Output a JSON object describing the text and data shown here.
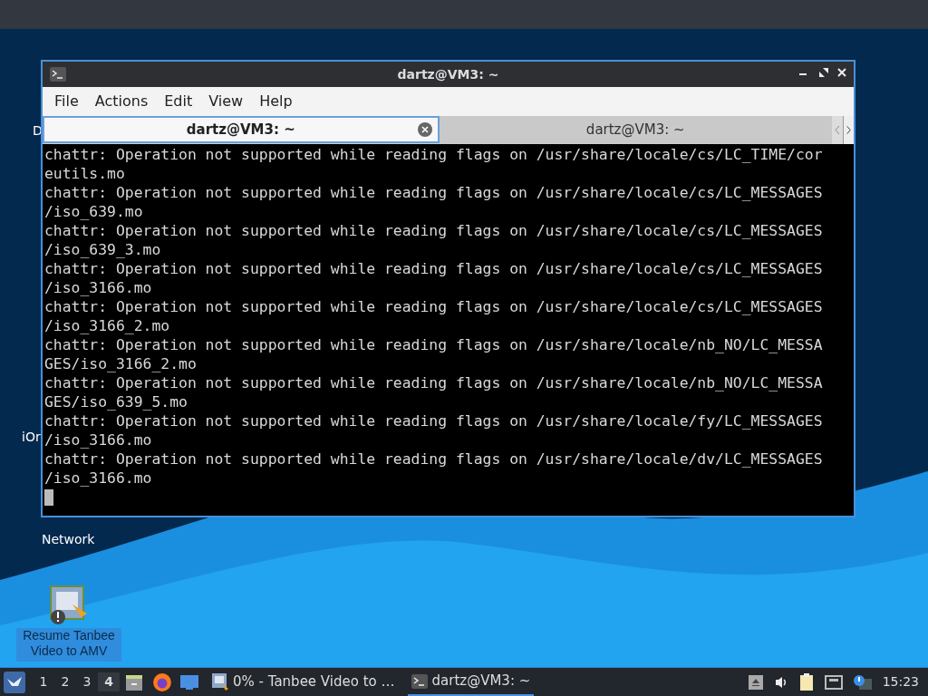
{
  "desktop_icons": [
    {
      "label": "D",
      "kind": "cut"
    },
    {
      "label": "iOr",
      "kind": "cut"
    },
    {
      "label": "Network",
      "kind": "network"
    },
    {
      "label": "Resume Tanbee Video to AMV",
      "kind": "app"
    }
  ],
  "window": {
    "title": "dartz@VM3: ~"
  },
  "menu": [
    "File",
    "Actions",
    "Edit",
    "View",
    "Help"
  ],
  "tabs": [
    {
      "label": "dartz@VM3: ~",
      "selected": true
    },
    {
      "label": "dartz@VM3: ~",
      "selected": false
    }
  ],
  "terminal_lines": [
    "chattr: Operation not supported while reading flags on /usr/share/locale/cs/LC_TIME/cor",
    "eutils.mo",
    "chattr: Operation not supported while reading flags on /usr/share/locale/cs/LC_MESSAGES",
    "/iso_639.mo",
    "chattr: Operation not supported while reading flags on /usr/share/locale/cs/LC_MESSAGES",
    "/iso_639_3.mo",
    "chattr: Operation not supported while reading flags on /usr/share/locale/cs/LC_MESSAGES",
    "/iso_3166.mo",
    "chattr: Operation not supported while reading flags on /usr/share/locale/cs/LC_MESSAGES",
    "/iso_3166_2.mo",
    "chattr: Operation not supported while reading flags on /usr/share/locale/nb_NO/LC_MESSA",
    "GES/iso_3166_2.mo",
    "chattr: Operation not supported while reading flags on /usr/share/locale/nb_NO/LC_MESSA",
    "GES/iso_639_5.mo",
    "chattr: Operation not supported while reading flags on /usr/share/locale/fy/LC_MESSAGES",
    "/iso_3166.mo",
    "chattr: Operation not supported while reading flags on /usr/share/locale/dv/LC_MESSAGES",
    "/iso_3166.mo"
  ],
  "taskbar": {
    "workspaces": [
      {
        "label": "1",
        "selected": false
      },
      {
        "label": "2",
        "selected": false
      },
      {
        "label": "3",
        "selected": false
      },
      {
        "label": "4",
        "selected": true
      }
    ],
    "tasks": [
      {
        "label": "0% - Tanbee Video to …",
        "selected": false,
        "kind": "app"
      },
      {
        "label": "dartz@VM3: ~",
        "selected": true,
        "kind": "terminal"
      }
    ],
    "clock": "15:23"
  }
}
